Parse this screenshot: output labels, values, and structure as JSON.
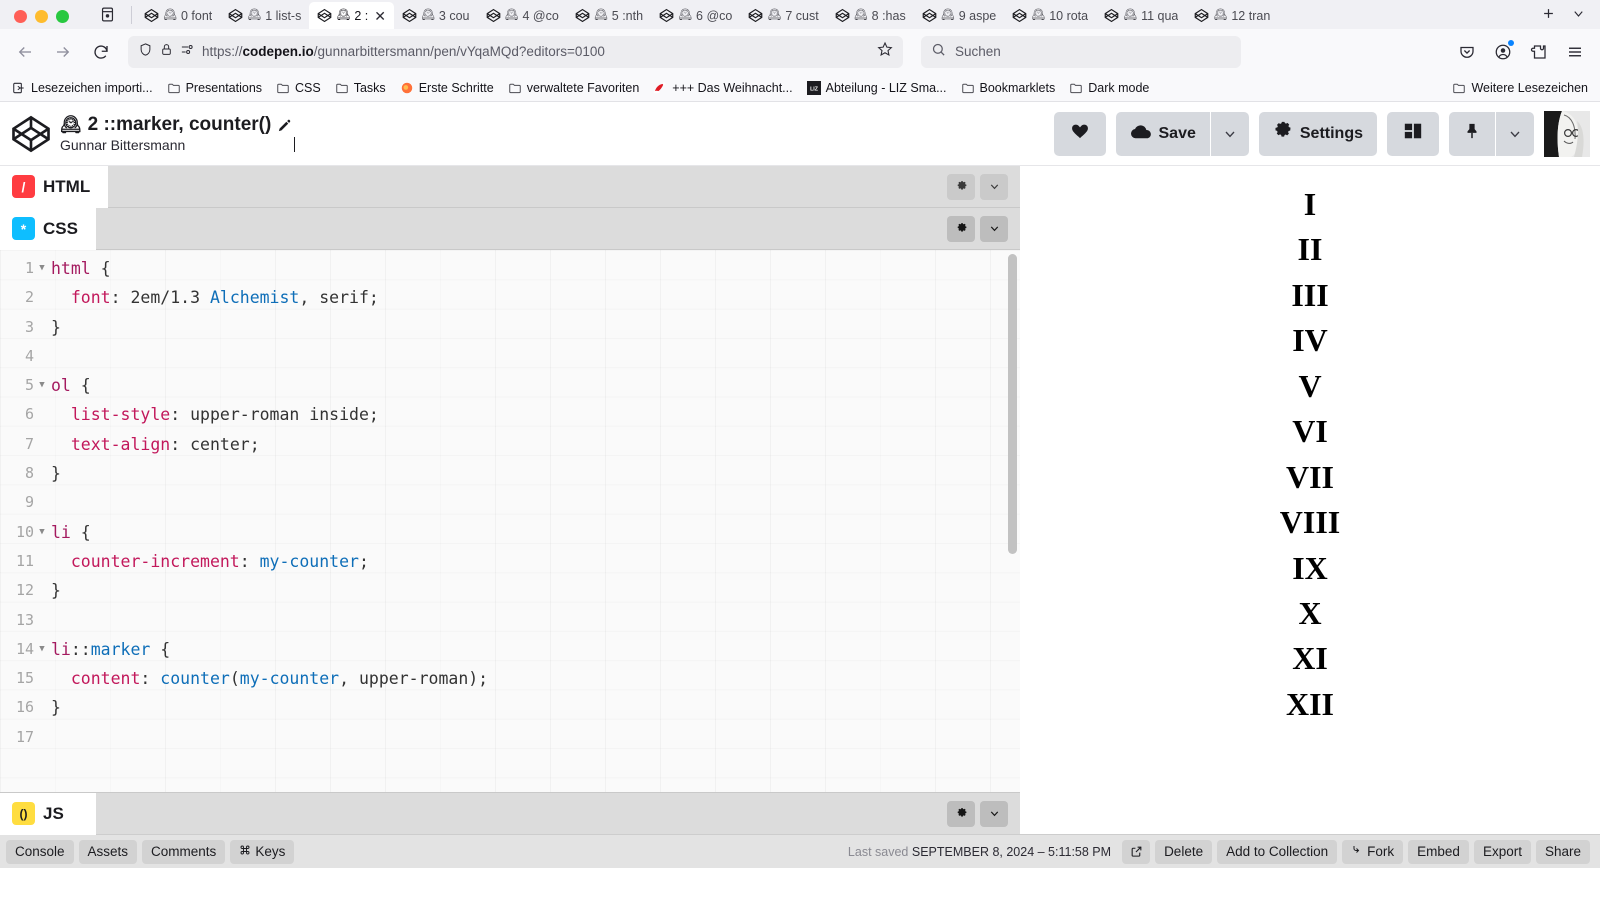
{
  "browser": {
    "window_controls": [
      "close",
      "minimize",
      "maximize"
    ],
    "tablist_icon": "tab-list-icon",
    "tabs": [
      {
        "label": "0 font",
        "icon": "codepen-favicon",
        "emoji": "clock-emoji",
        "active": false
      },
      {
        "label": "1 list-s",
        "icon": "codepen-favicon",
        "emoji": "clock-emoji",
        "active": false
      },
      {
        "label": "2 :",
        "icon": "codepen-favicon",
        "emoji": "clock-emoji",
        "active": true
      },
      {
        "label": "3 cou",
        "icon": "codepen-favicon",
        "emoji": "clock-emoji",
        "active": false
      },
      {
        "label": "4 @co",
        "icon": "codepen-favicon",
        "emoji": "clock-emoji",
        "active": false
      },
      {
        "label": "5 :nth",
        "icon": "codepen-favicon",
        "emoji": "clock-emoji",
        "active": false
      },
      {
        "label": "6 @co",
        "icon": "codepen-favicon",
        "emoji": "clock-emoji",
        "active": false
      },
      {
        "label": "7 cust",
        "icon": "codepen-favicon",
        "emoji": "clock-emoji",
        "active": false
      },
      {
        "label": "8 :has",
        "icon": "codepen-favicon",
        "emoji": "clock-emoji",
        "active": false
      },
      {
        "label": "9 aspe",
        "icon": "codepen-favicon",
        "emoji": "clock-emoji",
        "active": false
      },
      {
        "label": "10 rota",
        "icon": "codepen-favicon",
        "emoji": "clock-emoji",
        "active": false
      },
      {
        "label": "11 qua",
        "icon": "codepen-favicon",
        "emoji": "clock-emoji",
        "active": false
      },
      {
        "label": "12 tran",
        "icon": "codepen-favicon",
        "emoji": "clock-emoji",
        "active": false
      }
    ],
    "new_tab_label": "+",
    "tab_menu_label": "⌄",
    "nav": {
      "back": "back-arrow",
      "forward": "forward-arrow",
      "reload": "reload-arrow"
    },
    "url": {
      "scheme": "https://",
      "host": "codepen.io",
      "path": "/gunnarbittersmann/pen/vYqaMQd?editors=0100",
      "full": "https://codepen.io/gunnarbittersmann/pen/vYqaMQd?editors=0100"
    },
    "search_placeholder": "Suchen",
    "bookmarks": [
      {
        "label": "Lesezeichen importi...",
        "icon": "import-icon"
      },
      {
        "label": "Presentations",
        "icon": "folder-icon"
      },
      {
        "label": "CSS",
        "icon": "folder-icon"
      },
      {
        "label": "Tasks",
        "icon": "folder-icon"
      },
      {
        "label": "Erste Schritte",
        "icon": "firefox-icon"
      },
      {
        "label": "verwaltete Favoriten",
        "icon": "folder-icon"
      },
      {
        "label": "+++ Das Weihnacht...",
        "icon": "santa-hat-icon"
      },
      {
        "label": "Abteilung - LIZ Sma...",
        "icon": "liz-icon"
      },
      {
        "label": "Bookmarklets",
        "icon": "folder-icon"
      },
      {
        "label": "Dark mode",
        "icon": "folder-icon"
      }
    ],
    "bookmarks_overflow": {
      "label": "Weitere Lesezeichen",
      "icon": "folder-icon"
    }
  },
  "codepen": {
    "logo": "codepen-logo",
    "pen_title": "2 ::marker, counter()",
    "pen_title_emoji": "mantelpiece-clock-emoji",
    "edit_icon": "pencil-icon",
    "author": "Gunnar Bittersmann",
    "actions": {
      "love_icon": "heart-icon",
      "save_label": "Save",
      "save_icon": "cloud-icon",
      "save_caret": "chevron-down-icon",
      "settings_label": "Settings",
      "settings_icon": "gear-icon",
      "layout_icon": "layout-icon",
      "pin_icon": "pin-icon",
      "pin_caret": "chevron-down-icon",
      "avatar": "user-avatar"
    },
    "panels": [
      {
        "name": "HTML",
        "icon_char": "/",
        "icon_class": "html"
      },
      {
        "name": "CSS",
        "icon_char": "*",
        "icon_class": "css"
      },
      {
        "name": "JS",
        "icon_char": "()",
        "icon_class": "js"
      }
    ],
    "panel_actions": {
      "settings": "gear-icon",
      "collapse": "chevron-down-icon"
    },
    "css_code": [
      {
        "n": "1",
        "fold": true,
        "tokens": [
          {
            "t": "html",
            "c": "sel"
          },
          {
            "t": " {",
            "c": "punc"
          }
        ]
      },
      {
        "n": "2",
        "fold": false,
        "tokens": [
          {
            "t": "  font",
            "c": "prop"
          },
          {
            "t": ": 2em/1.3 ",
            "c": "val"
          },
          {
            "t": "Alchemist",
            "c": "ident"
          },
          {
            "t": ", serif;",
            "c": "val"
          }
        ]
      },
      {
        "n": "3",
        "fold": false,
        "tokens": [
          {
            "t": "}",
            "c": "punc"
          }
        ]
      },
      {
        "n": "4",
        "fold": false,
        "tokens": []
      },
      {
        "n": "5",
        "fold": true,
        "tokens": [
          {
            "t": "ol",
            "c": "sel"
          },
          {
            "t": " {",
            "c": "punc"
          }
        ]
      },
      {
        "n": "6",
        "fold": false,
        "tokens": [
          {
            "t": "  list-style",
            "c": "prop"
          },
          {
            "t": ": upper-roman inside;",
            "c": "val"
          }
        ]
      },
      {
        "n": "7",
        "fold": false,
        "tokens": [
          {
            "t": "  text-align",
            "c": "prop"
          },
          {
            "t": ": center;",
            "c": "val"
          }
        ]
      },
      {
        "n": "8",
        "fold": false,
        "tokens": [
          {
            "t": "}",
            "c": "punc"
          }
        ]
      },
      {
        "n": "9",
        "fold": false,
        "tokens": []
      },
      {
        "n": "10",
        "fold": true,
        "tokens": [
          {
            "t": "li",
            "c": "sel"
          },
          {
            "t": " {",
            "c": "punc"
          }
        ]
      },
      {
        "n": "11",
        "fold": false,
        "tokens": [
          {
            "t": "  counter-increment",
            "c": "prop"
          },
          {
            "t": ": ",
            "c": "val"
          },
          {
            "t": "my-counter",
            "c": "ident"
          },
          {
            "t": ";",
            "c": "val"
          }
        ]
      },
      {
        "n": "12",
        "fold": false,
        "tokens": [
          {
            "t": "}",
            "c": "punc"
          }
        ]
      },
      {
        "n": "13",
        "fold": false,
        "tokens": []
      },
      {
        "n": "14",
        "fold": true,
        "tokens": [
          {
            "t": "li",
            "c": "sel"
          },
          {
            "t": "::",
            "c": "punc"
          },
          {
            "t": "marker",
            "c": "pseu"
          },
          {
            "t": " {",
            "c": "punc"
          }
        ]
      },
      {
        "n": "15",
        "fold": false,
        "tokens": [
          {
            "t": "  content",
            "c": "prop"
          },
          {
            "t": ": ",
            "c": "val"
          },
          {
            "t": "counter",
            "c": "ident"
          },
          {
            "t": "(",
            "c": "val"
          },
          {
            "t": "my-counter",
            "c": "ident"
          },
          {
            "t": ", upper-roman);",
            "c": "val"
          }
        ]
      },
      {
        "n": "16",
        "fold": false,
        "tokens": [
          {
            "t": "}",
            "c": "punc"
          }
        ]
      },
      {
        "n": "17",
        "fold": false,
        "tokens": []
      }
    ],
    "preview_items": [
      "I",
      "II",
      "III",
      "IV",
      "V",
      "VI",
      "VII",
      "VIII",
      "IX",
      "X",
      "XI",
      "XII"
    ],
    "bottom_bar": {
      "left_buttons": [
        {
          "label": "Console",
          "icon": null
        },
        {
          "label": "Assets",
          "icon": null
        },
        {
          "label": "Comments",
          "icon": null
        },
        {
          "label": "Keys",
          "icon": "command-icon"
        }
      ],
      "saved_label": "Last saved",
      "saved_value": "SEPTEMBER 8, 2024 – 5:11:58 PM",
      "open_icon": "external-link-icon",
      "right_buttons": [
        {
          "label": "Delete",
          "icon": null
        },
        {
          "label": "Add to Collection",
          "icon": null
        },
        {
          "label": "Fork",
          "icon": "fork-icon"
        },
        {
          "label": "Embed",
          "icon": null
        },
        {
          "label": "Export",
          "icon": null
        },
        {
          "label": "Share",
          "icon": null
        }
      ]
    }
  },
  "colors": {
    "html_accent": "#ff3c41",
    "css_accent": "#0ebeff",
    "js_accent": "#ffdd40",
    "selector": "#a41a5f",
    "property": "#c2185b",
    "identifier": "#0e6eb8",
    "chrome_bg": "#f9f9fb"
  }
}
